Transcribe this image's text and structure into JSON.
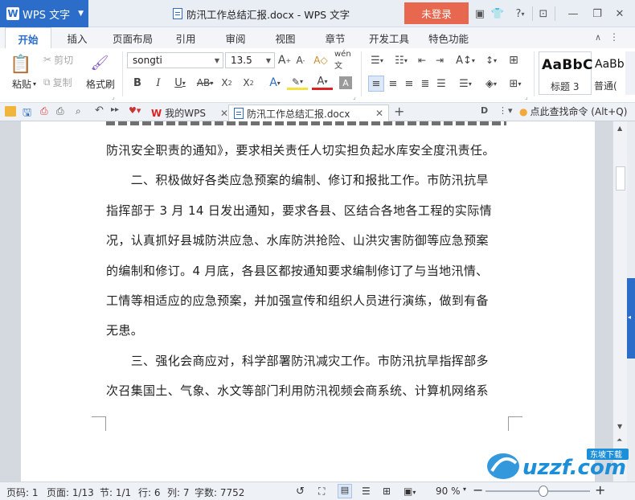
{
  "app": {
    "name": "WPS 文字",
    "logo_letter": "W"
  },
  "title_bar": {
    "document_title": "防汛工作总结汇报.docx - WPS 文字",
    "login_label": "未登录"
  },
  "menu_tabs": [
    "开始",
    "插入",
    "页面布局",
    "引用",
    "审阅",
    "视图",
    "章节",
    "开发工具",
    "特色功能"
  ],
  "ribbon": {
    "paste_label": "粘贴",
    "cut_label": "剪切",
    "copy_label": "复制",
    "format_painter_label": "格式刷",
    "font_name": "songti",
    "font_size": "13.5",
    "style_heading3_preview": "AaBbC",
    "style_heading3_label": "标题 3",
    "style_normal_preview": "AaBb",
    "style_normal_label": "普通("
  },
  "doc_tabs": {
    "wps_tab": "我的WPS",
    "doc_tab": "防汛工作总结汇报.docx",
    "find_command": "点此查找命令 (Alt+Q)"
  },
  "document": {
    "lines": [
      "防汛安全职责的通知》，要求相关责任人切实担负起水库安全度汛责任。",
      "　　二、积极做好各类应急预案的编制、修订和报批工作。市防汛抗旱",
      "指挥部于 3 月 14 日发出通知，要求各县、区结合各地各工程的实际情",
      "况，认真抓好县城防洪应急、水库防洪抢险、山洪灾害防御等应急预案",
      "的编制和修订。4 月底，各县区都按通知要求编制修订了与当地汛情、",
      "工情等相适应的应急预案，并加强宣传和组织人员进行演练，做到有备",
      "无患。",
      "　　三、强化会商应对，科学部署防汛减灾工作。市防汛抗旱指挥部多",
      "次召集国土、气象、水文等部门利用防汛视频会商系统、计算机网络系"
    ]
  },
  "status_bar": {
    "page": "页码: 1",
    "pages": "页面: 1/13",
    "section": "节: 1/1",
    "row": "行: 6",
    "col": "列: 7",
    "word_count": "字数: 7752",
    "zoom": "90 %",
    "zoom_fraction": 0.55
  },
  "watermark": {
    "site": "uzzf.com",
    "brand": "东坡下载"
  },
  "colors": {
    "accent": "#2b6dc9",
    "login": "#e8674f",
    "scroll_active": "#2b6dc9"
  }
}
